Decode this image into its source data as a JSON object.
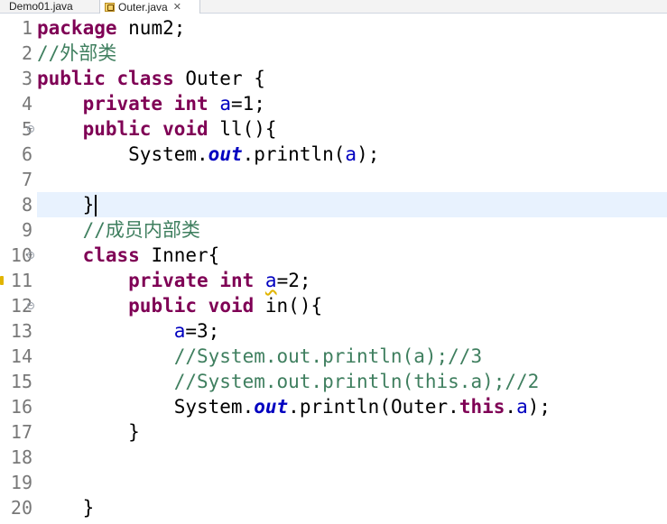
{
  "tabs": [
    {
      "label": "Demo01.java",
      "active": false
    },
    {
      "label": "Outer.java",
      "active": true,
      "close": "✕"
    }
  ],
  "gutter": [
    "1",
    "2",
    "3",
    "4",
    "5",
    "6",
    "7",
    "8",
    "9",
    "10",
    "11",
    "12",
    "13",
    "14",
    "15",
    "16",
    "17",
    "18",
    "19",
    "20"
  ],
  "code": {
    "l1_kw": "package",
    "l1_rest": " num2;",
    "l2_cm": "//外部类",
    "l3_kw1": "public",
    "l3_kw2": "class",
    "l3_rest": " Outer {",
    "l4_ind": "    ",
    "l4_kw1": "private",
    "l4_kw2": "int",
    "l4_var": "a",
    "l4_rest": "=1;",
    "l5_ind": "    ",
    "l5_kw1": "public",
    "l5_kw2": "void",
    "l5_rest": " ll(){",
    "l6_ind": "        ",
    "l6_a": "System.",
    "l6_out": "out",
    "l6_b": ".println(",
    "l6_var": "a",
    "l6_c": ");",
    "l8_ind": "    ",
    "l8_rest": "}",
    "l9_ind": "    ",
    "l9_cm": "//成员内部类",
    "l10_ind": "    ",
    "l10_kw": "class",
    "l10_rest": " Inner{",
    "l11_ind": "        ",
    "l11_kw1": "private",
    "l11_kw2": "int",
    "l11_var": "a",
    "l11_rest": "=2;",
    "l12_ind": "        ",
    "l12_kw1": "public",
    "l12_kw2": "void",
    "l12_rest": " in(){",
    "l13_ind": "            ",
    "l13_var": "a",
    "l13_rest": "=3;",
    "l14_ind": "            ",
    "l14_cm": "//System.out.println(a);//3",
    "l15_ind": "            ",
    "l15_cm": "//System.out.println(this.a);//2",
    "l16_ind": "            ",
    "l16_a": "System.",
    "l16_out": "out",
    "l16_b": ".println(Outer.",
    "l16_this": "this",
    "l16_c": ".",
    "l16_var": "a",
    "l16_d": ");",
    "l17_ind": "        ",
    "l17_rest": "}",
    "l20_ind": "    ",
    "l20_rest": "}"
  }
}
